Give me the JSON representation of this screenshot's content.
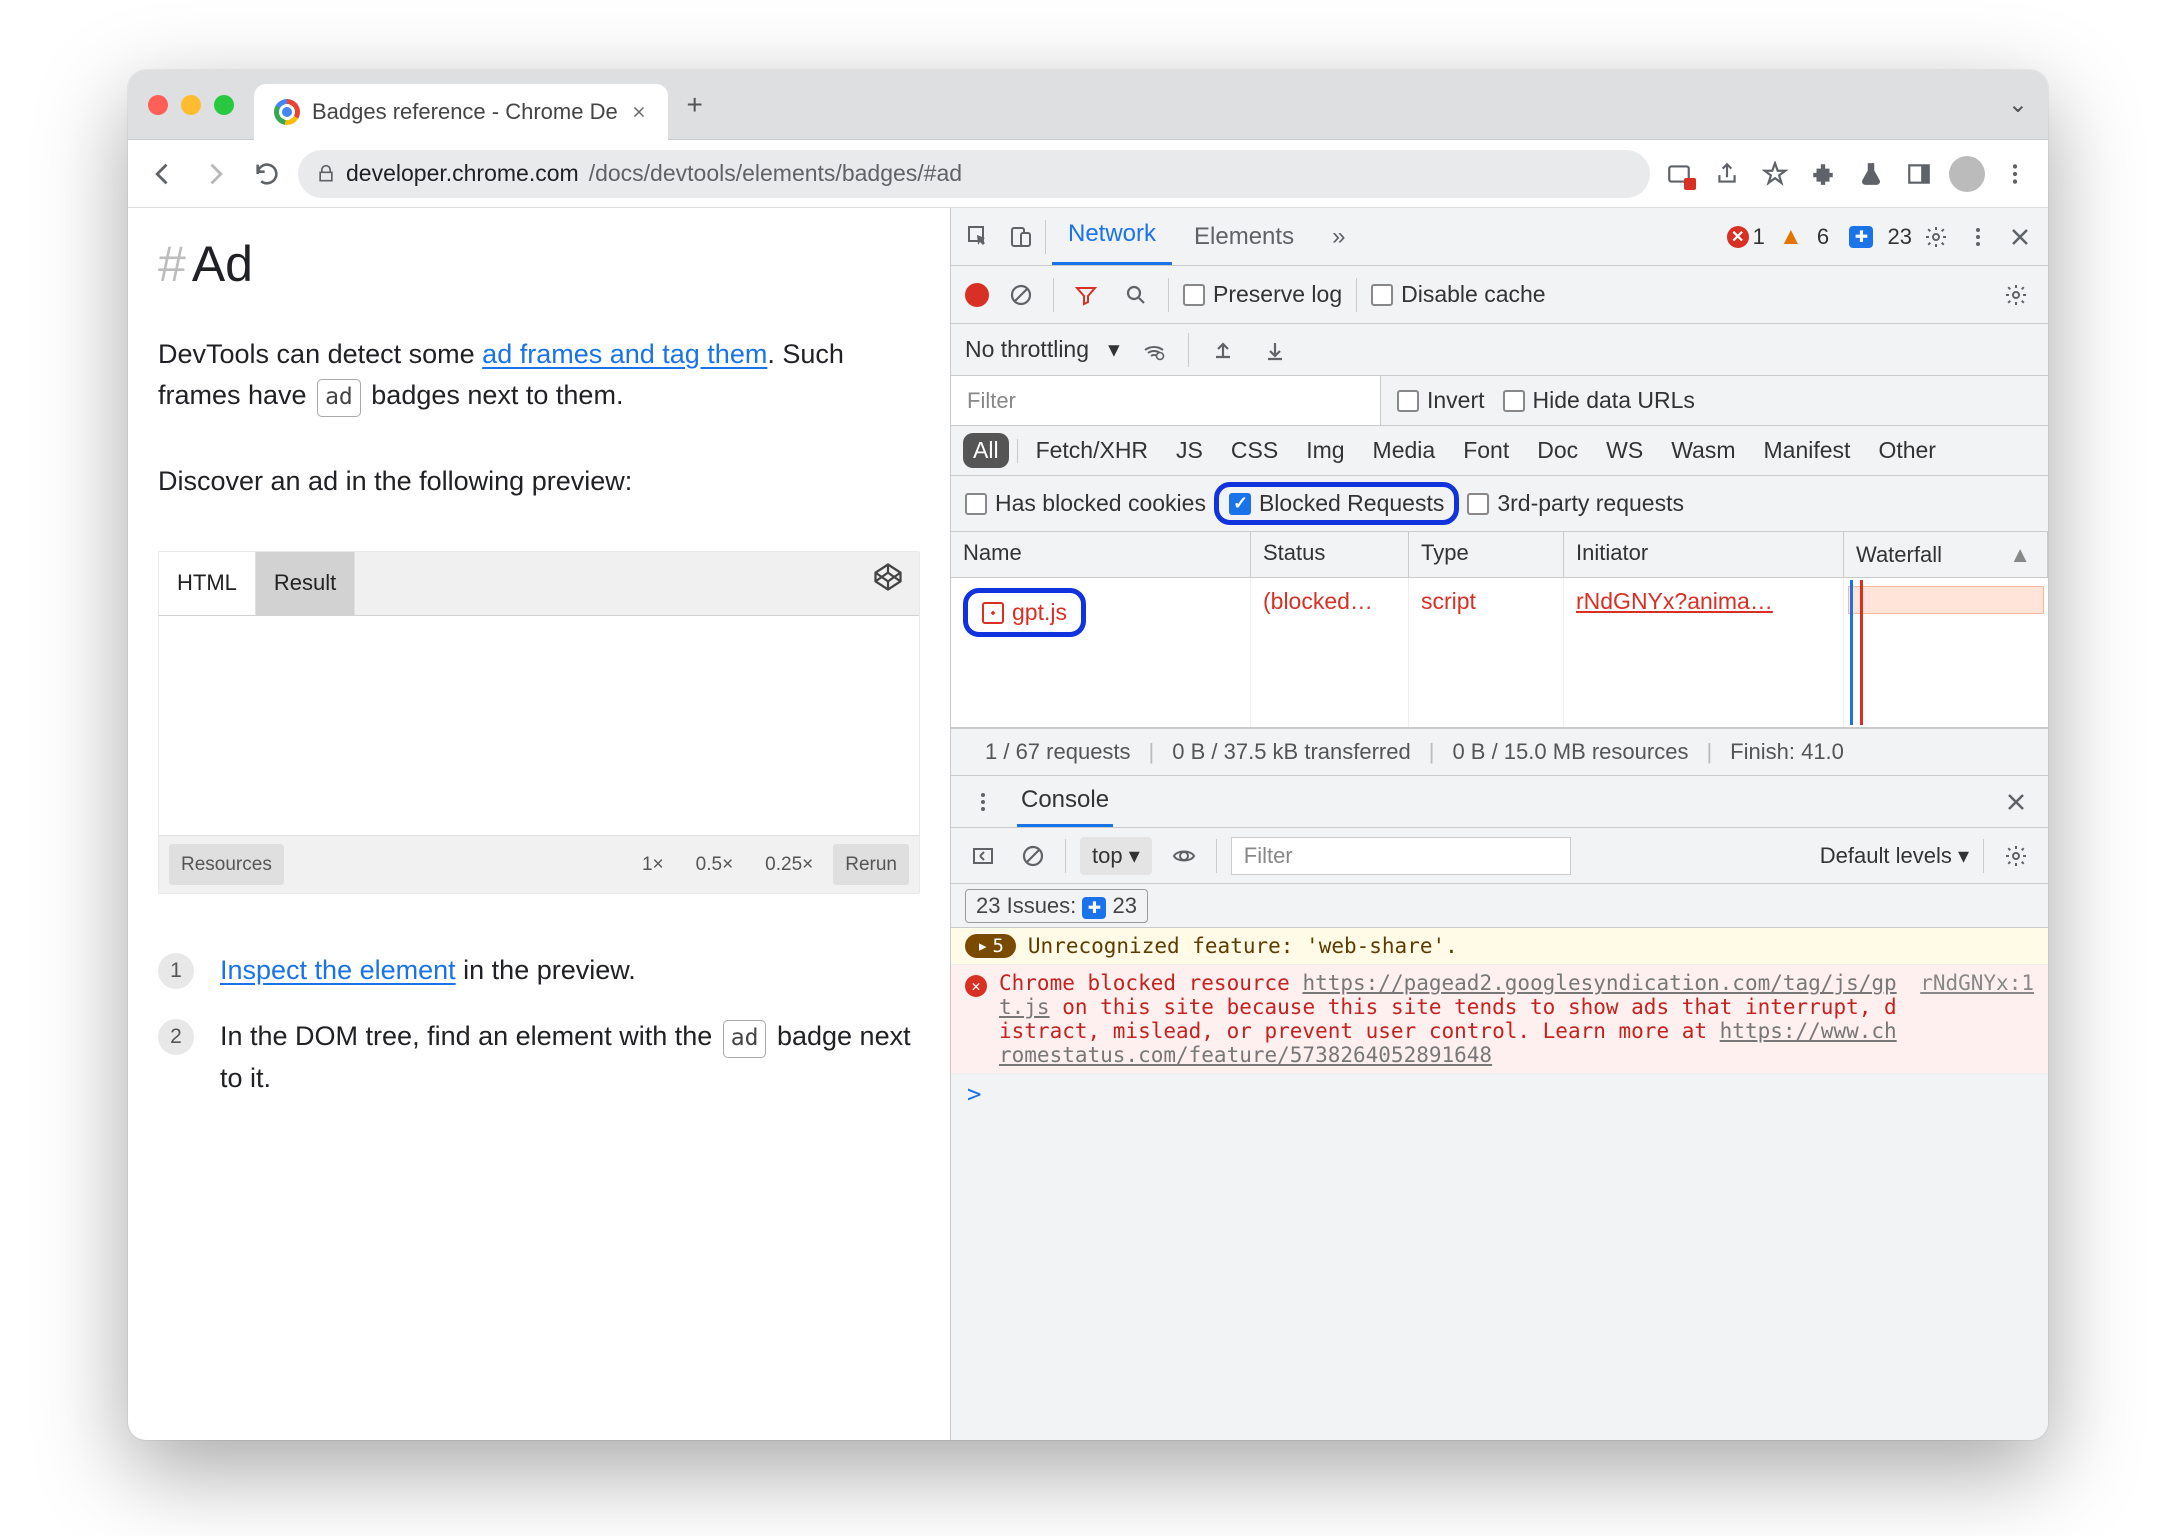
{
  "browser": {
    "tab_title": "Badges reference - Chrome De",
    "url_host": "developer.chrome.com",
    "url_path": "/docs/devtools/elements/badges/#ad"
  },
  "article": {
    "h1_anchor": "#",
    "h1": "Ad",
    "p1_a": "DevTools can detect some ",
    "p1_link": "ad frames and tag them",
    "p1_b": ". Such frames have ",
    "p1_badge": "ad",
    "p1_c": " badges next to them.",
    "p2": "Discover an ad in the following preview:",
    "embed_tabs": {
      "html": "HTML",
      "result": "Result"
    },
    "embed_footer": {
      "resources": "Resources",
      "x1": "1×",
      "x05": "0.5×",
      "x025": "0.25×",
      "rerun": "Rerun"
    },
    "step1_num": "1",
    "step1_link": "Inspect the element",
    "step1_rest": " in the preview.",
    "step2_num": "2",
    "step2_a": "In the DOM tree, find an element with the ",
    "step2_badge": "ad",
    "step2_b": " badge next to it."
  },
  "devtools": {
    "tabs": {
      "network": "Network",
      "elements": "Elements"
    },
    "counts": {
      "errors": "1",
      "warnings": "6",
      "issues": "23"
    },
    "controls": {
      "preserve": "Preserve log",
      "disable_cache": "Disable cache"
    },
    "throttle": {
      "label": "No throttling"
    },
    "filter": {
      "placeholder": "Filter",
      "invert": "Invert",
      "hide_urls": "Hide data URLs"
    },
    "types": [
      "All",
      "Fetch/XHR",
      "JS",
      "CSS",
      "Img",
      "Media",
      "Font",
      "Doc",
      "WS",
      "Wasm",
      "Manifest",
      "Other"
    ],
    "checks": {
      "blocked_cookies": "Has blocked cookies",
      "blocked_requests": "Blocked Requests",
      "third_party": "3rd-party requests"
    },
    "columns": {
      "name": "Name",
      "status": "Status",
      "type": "Type",
      "initiator": "Initiator",
      "waterfall": "Waterfall"
    },
    "row": {
      "name": "gpt.js",
      "status": "(blocked…",
      "type": "script",
      "initiator": "rNdGNYx?anima…"
    },
    "summary": {
      "requests": "1 / 67 requests",
      "transferred": "0 B / 37.5 kB transferred",
      "resources": "0 B / 15.0 MB resources",
      "finish": "Finish: 41.0"
    },
    "console": {
      "title": "Console",
      "context": "top",
      "filter_placeholder": "Filter",
      "levels": "Default levels",
      "issues_label": "23 Issues:",
      "issues_count": "23",
      "warn_count": "5",
      "warn_text": "Unrecognized feature: 'web-share'.",
      "err_a": "Chrome blocked resource ",
      "err_url1": "https://pagead2.googlesyndication.com/tag/js/gpt.js",
      "err_b": " on this site because this site tends to show ads that interrupt, distract, mislead, or prevent user control. Learn more at ",
      "err_url2": "https://www.chromestatus.com/feature/5738264052891648",
      "err_src": "rNdGNYx:1",
      "prompt": ">"
    }
  }
}
